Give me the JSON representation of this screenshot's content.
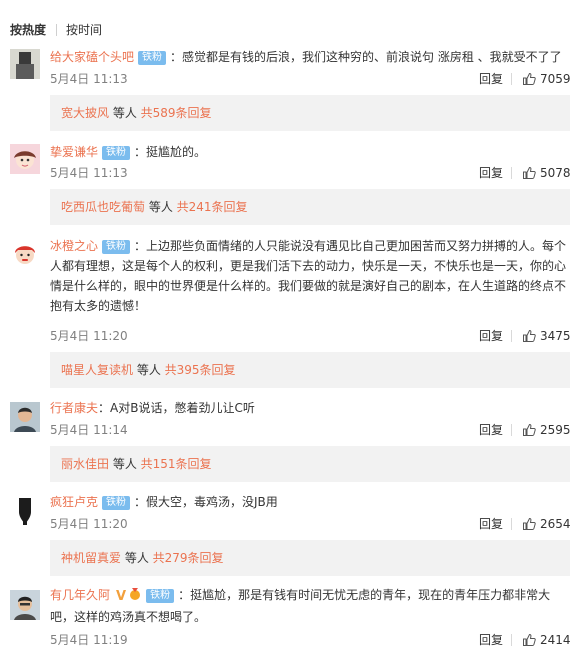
{
  "sort_tabs": {
    "hot": "按热度",
    "time": "按时间"
  },
  "labels": {
    "reply": "回复",
    "and_others": " 等人 "
  },
  "comments": [
    {
      "user": "给大家磕个头吧",
      "badge": "铁粉",
      "text": "：感觉都是有钱的后浪，我们这种穷的、前浪说句 涨房租  、我就受不了了",
      "time": "5月4日 11:13",
      "likes": "7059",
      "sub_user": "宽大披风",
      "sub_count": "共589条回复"
    },
    {
      "user": "挚爱谦华",
      "badge": "铁粉",
      "text": "：挺尴尬的。",
      "time": "5月4日 11:13",
      "likes": "5078",
      "sub_user": "吃西瓜也吃葡萄",
      "sub_count": "共241条回复"
    },
    {
      "user": "冰橙之心",
      "badge": "铁粉",
      "text": "：上边那些负面情绪的人只能说没有遇见比自己更加困苦而又努力拼搏的人。每个人都有理想，这是每个人的权利，更是我们活下去的动力，快乐是一天，不快乐也是一天，你的心情是什么样的，眼中的世界便是什么样的。我们要做的就是演好自己的剧本，在人生道路的终点不抱有太多的遗憾！",
      "time": "5月4日 11:20",
      "likes": "3475",
      "sub_user": "喵星人复读机",
      "sub_count": "共395条回复"
    },
    {
      "user": "行者康夫",
      "badge": "",
      "text": "：A对B说话，憋着劲儿让C听",
      "time": "5月4日 11:14",
      "likes": "2595",
      "sub_user": "丽水佳田",
      "sub_count": "共151条回复"
    },
    {
      "user": "疯狂卢克",
      "badge": "铁粉",
      "text": "：假大空，毒鸡汤，没JB用",
      "time": "5月4日 11:20",
      "likes": "2654",
      "sub_user": "衶机留真爱",
      "sub_count": "共279条回复"
    },
    {
      "user": "有几年久阿",
      "badge": "铁粉",
      "vip": "V",
      "text": "：挺尴尬，那是有钱有时间无忧无虑的青年，现在的青年压力都非常大吧，这样的鸡汤真不想喝了。",
      "time": "5月4日 11:19",
      "likes": "2414"
    }
  ],
  "colors": {
    "username": "#eb7350",
    "badge_bg": "#7bbcee",
    "meta": "#808080",
    "sub_bg": "#f2f2f2",
    "vip": "#f2a03d"
  }
}
